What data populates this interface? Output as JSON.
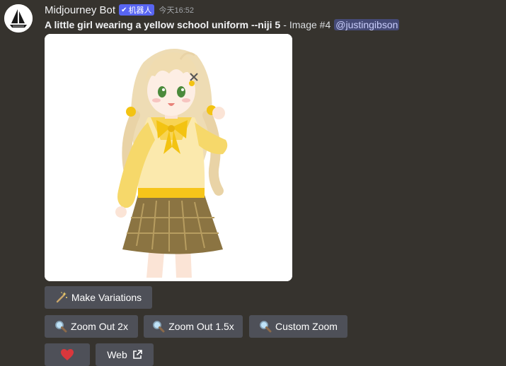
{
  "message": {
    "author": "Midjourney Bot",
    "bot_tag": "机器人",
    "timestamp": "今天16:52",
    "prompt": "A little girl wearing a yellow school uniform --niji 5",
    "separator": "-",
    "image_label": "Image #4",
    "mention": "@justingibson"
  },
  "buttons": {
    "make_variations": "Make Variations",
    "zoom_out_2x": "Zoom Out 2x",
    "zoom_out_1_5x": "Zoom Out 1.5x",
    "custom_zoom": "Custom Zoom",
    "web": "Web"
  },
  "icons": {
    "make_variations": "magic-wand-icon",
    "zoom": "magnifier-icon",
    "favorite": "heart-icon",
    "web": "external-link-icon",
    "avatar": "sailboat-icon",
    "bot_tag": "checkmark-icon"
  },
  "colors": {
    "background": "#36332e",
    "button": "#4e5058",
    "bot_tag": "#5865f2",
    "mention_bg": "#454a77",
    "mention_text": "#c9cdfb",
    "heart": "#da373c"
  }
}
